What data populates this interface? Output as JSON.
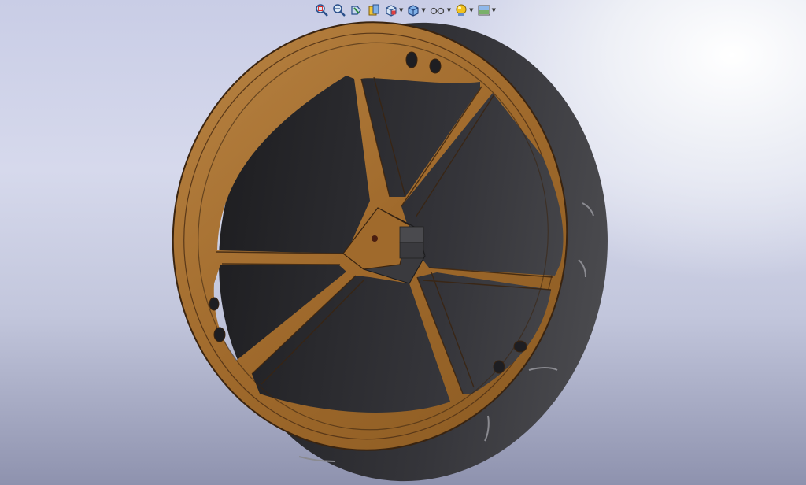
{
  "heads_up_toolbar": {
    "tools": [
      {
        "icon": "zoom-to-fit-icon",
        "dropdown": false
      },
      {
        "icon": "zoom-to-area-icon",
        "dropdown": false
      },
      {
        "icon": "previous-view-icon",
        "dropdown": false
      },
      {
        "icon": "section-view-icon",
        "dropdown": false
      },
      {
        "icon": "view-orientation-icon",
        "dropdown": true
      },
      {
        "icon": "display-style-icon",
        "dropdown": true
      },
      {
        "icon": "hide-show-items-icon",
        "dropdown": true
      },
      {
        "icon": "edit-appearance-icon",
        "dropdown": true
      },
      {
        "icon": "apply-scene-icon",
        "dropdown": true
      }
    ]
  },
  "model": {
    "part": "wheel",
    "spoke_count": 5,
    "colors": {
      "face": "#a06a2c",
      "face_light": "#b98443",
      "edge": "#3a2410",
      "rim_side": "#2e2e30",
      "rim_side_light": "#4a4a4e",
      "hole": "#1e1e22"
    }
  }
}
